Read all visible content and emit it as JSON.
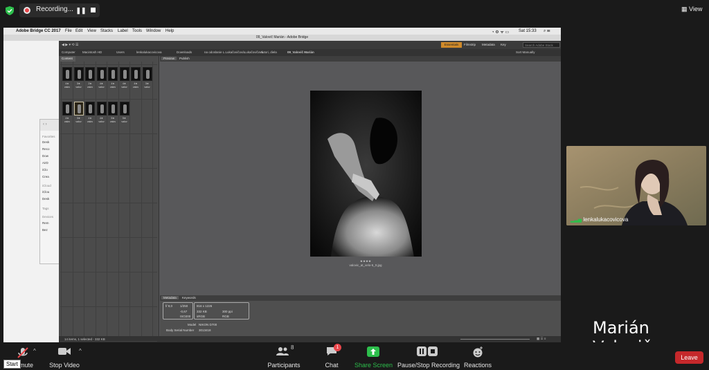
{
  "zoom": {
    "recording_label": "Recording...",
    "pause_glyph": "❚❚",
    "view_label": "View",
    "participant_count": "8",
    "chat_badge": "1",
    "controls": {
      "mute": "mute",
      "stop_video": "Stop Video",
      "participants": "Participants",
      "chat": "Chat",
      "share_screen": "Share Screen",
      "pause_stop_recording": "Pause/Stop Recording",
      "reactions": "Reactions",
      "leave": "Leave"
    },
    "tooltip": "Start",
    "video_participant_name": "lenkalukacovicova",
    "active_speaker_name": "Marián Valovič",
    "colors": {
      "share_green": "#2dbf4c",
      "leave_red": "#c5282b",
      "record_red": "#e8454a"
    }
  },
  "mac_menubar": {
    "app": "Adobe Bridge CC 2017",
    "menus": [
      "File",
      "Edit",
      "View",
      "Stacks",
      "Label",
      "Tools",
      "Window",
      "Help"
    ],
    "clock": "Sat 15:33"
  },
  "bridge": {
    "window_title": "09_Valovič Marián - Adobe Bridge",
    "workspaces": [
      "Essentials",
      "Filmstrip",
      "Metadata",
      "Key"
    ],
    "search_placeholder": "Search Adobe Stock",
    "sort_label": "Sort Manually",
    "path": [
      "Computer",
      "Macintosh HD",
      "Users",
      "lenkalukacovicova",
      "Downloads",
      "na odoslanie L.LukačovičováLukačovičová",
      "Autori, diela",
      "09_Valovič Marián"
    ],
    "content_tab": "Content",
    "preview_tab": "Preview",
    "publish_tab": "Publish",
    "metadata_tab": "Metadata",
    "keywords_tab": "Keywords",
    "photo_caption": "valovic_at_velo-5_0.jpg",
    "photo_stars": "★★★★",
    "thumb_labels": [
      "4★",
      "3★",
      "2★",
      "4★",
      "4★",
      "4★",
      "4★",
      "3★",
      "4★",
      "3★",
      "4★",
      "4★",
      "5★",
      "5★"
    ],
    "thumb_name": "valov",
    "metadata": {
      "aperture": "f/ 9,0",
      "shutter": "1/250",
      "ev": "-0,67",
      "iso": "ISO200",
      "dims": "816 x 1226",
      "size": "332 KB",
      "dpi": "300 ppi",
      "profile": "sRGB",
      "mode": "RGB",
      "model_label": "Model",
      "model_value": "NIKON D700",
      "serial_label": "Body Serial Number",
      "serial_value": "3013418"
    },
    "status": "14 items, 1 selected - 332 KB"
  },
  "finder": {
    "favorites": "Favorites",
    "items": [
      "Desk",
      "Reco",
      "Dow",
      "AirD",
      "iClo",
      "Crea"
    ],
    "icloud": "iCloud",
    "icloud_items": [
      "iClou",
      "Desk"
    ],
    "tags": "Tags",
    "devices": "Devices",
    "device_items": [
      "Rem",
      "Bez"
    ]
  }
}
